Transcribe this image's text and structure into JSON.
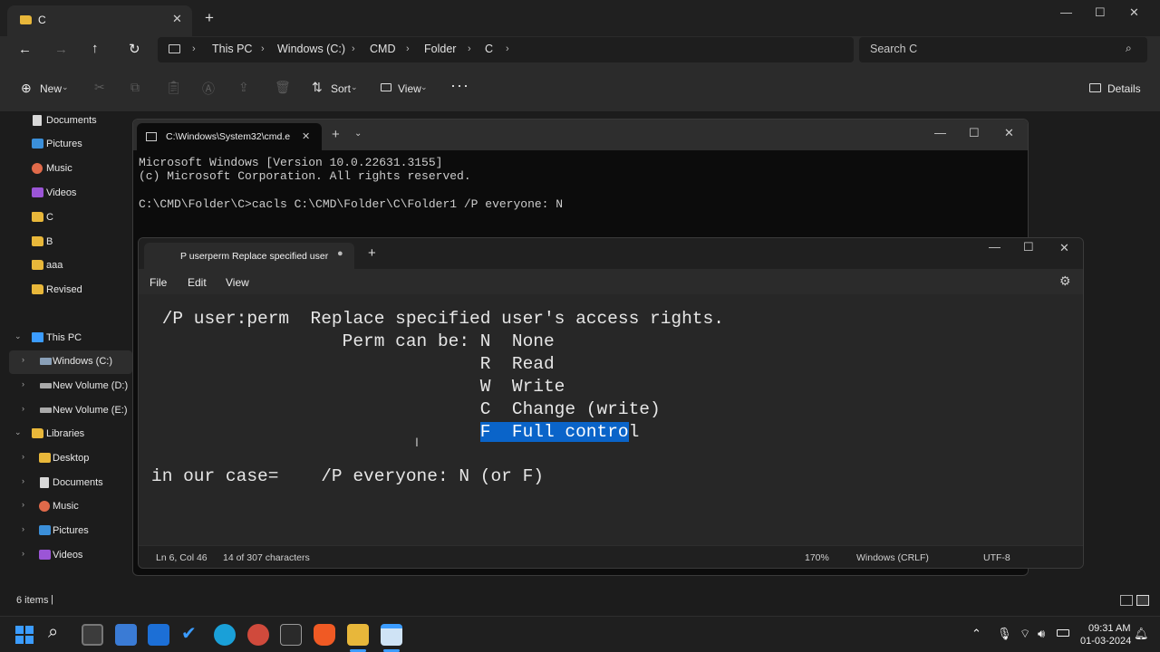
{
  "explorer": {
    "tab_title": "C",
    "breadcrumbs": [
      "This PC",
      "Windows (C:)",
      "CMD",
      "Folder",
      "C"
    ],
    "search_placeholder": "Search C",
    "toolbar": {
      "new_label": "New",
      "sort_label": "Sort",
      "view_label": "View",
      "details_label": "Details"
    },
    "quick_access": [
      {
        "label": "Documents",
        "icon": "documents-icon"
      },
      {
        "label": "Pictures",
        "icon": "pictures-icon"
      },
      {
        "label": "Music",
        "icon": "music-icon"
      },
      {
        "label": "Videos",
        "icon": "videos-icon"
      },
      {
        "label": "C",
        "icon": "folder-icon"
      },
      {
        "label": "B",
        "icon": "folder-icon"
      },
      {
        "label": "aaa",
        "icon": "folder-icon"
      },
      {
        "label": "Revised",
        "icon": "folder-icon"
      }
    ],
    "this_pc": {
      "label": "This PC",
      "drives": [
        "Windows (C:)",
        "New Volume (D:)",
        "New Volume (E:)"
      ]
    },
    "libraries": {
      "label": "Libraries",
      "items": [
        "Desktop",
        "Documents",
        "Music",
        "Pictures",
        "Videos"
      ]
    },
    "status_items": "6 items"
  },
  "cmd": {
    "tab_title": "C:\\Windows\\System32\\cmd.e",
    "lines": [
      "Microsoft Windows [Version 10.0.22631.3155]",
      "(c) Microsoft Corporation. All rights reserved.",
      "",
      "C:\\CMD\\Folder\\C>cacls C:\\CMD\\Folder\\C\\Folder1 /P everyone: N"
    ]
  },
  "notepad": {
    "tab_title": "P userperm  Replace specified user",
    "menu": [
      "File",
      "Edit",
      "View"
    ],
    "lines": [
      " /P user:perm  Replace specified user's access rights.",
      "                  Perm can be: N  None",
      "                               R  Read",
      "                               W  Write",
      "                               C  Change (write)",
      "                               ",
      "",
      "in our case=    /P everyone: N (or F)"
    ],
    "selected_text": "F  Full contro",
    "after_selection": "l",
    "status": {
      "position": "Ln 6, Col 46",
      "chars": "14 of 307 characters",
      "zoom": "170%",
      "eol": "Windows (CRLF)",
      "encoding": "UTF-8"
    }
  },
  "taskbar": {
    "time": "09:31 AM",
    "date": "01-03-2024"
  },
  "colors": {
    "selection": "#0a64c9",
    "folder": "#e8b73a",
    "accent": "#3b9cff"
  }
}
